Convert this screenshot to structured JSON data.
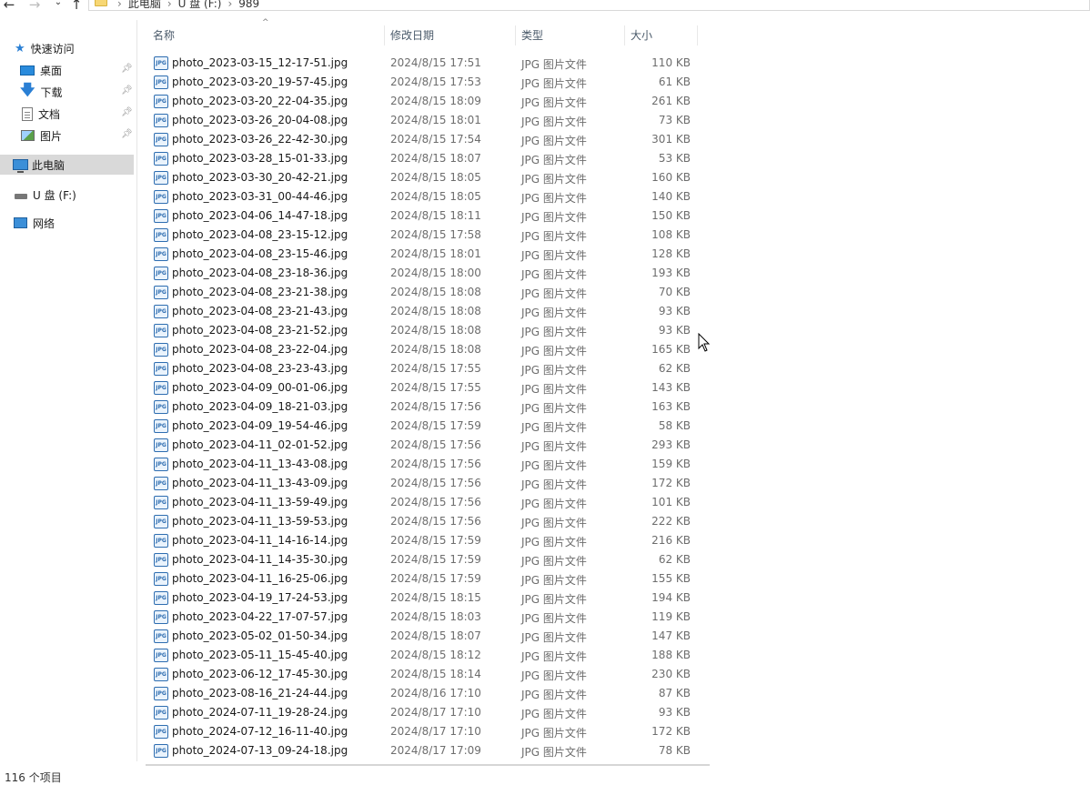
{
  "address_bar": {
    "back_icon": "arrow-left-icon",
    "forward_icon": "arrow-right-icon",
    "recent_icon": "chevron-down-icon",
    "up_icon": "arrow-up-icon",
    "breadcrumbs": [
      "此电脑",
      "U 盘 (F:)",
      "989"
    ]
  },
  "sidebar": {
    "items": [
      {
        "label": "快速访问",
        "icon": "star-icon",
        "pinned": false
      },
      {
        "label": "桌面",
        "icon": "desktop-icon",
        "pinned": true
      },
      {
        "label": "下载",
        "icon": "download-icon",
        "pinned": true
      },
      {
        "label": "文档",
        "icon": "document-icon",
        "pinned": true
      },
      {
        "label": "图片",
        "icon": "pictures-icon",
        "pinned": true
      },
      {
        "label": "此电脑",
        "icon": "computer-icon",
        "selected": true
      },
      {
        "label": "U 盘 (F:)",
        "icon": "usb-drive-icon"
      },
      {
        "label": "网络",
        "icon": "network-icon"
      }
    ]
  },
  "columns": {
    "name": "名称",
    "date": "修改日期",
    "type": "类型",
    "size": "大小"
  },
  "files": [
    {
      "name": "photo_2023-03-15_12-17-51.jpg",
      "date": "2024/8/15 17:51",
      "type": "JPG 图片文件",
      "size": "110 KB"
    },
    {
      "name": "photo_2023-03-20_19-57-45.jpg",
      "date": "2024/8/15 17:53",
      "type": "JPG 图片文件",
      "size": "61 KB"
    },
    {
      "name": "photo_2023-03-20_22-04-35.jpg",
      "date": "2024/8/15 18:09",
      "type": "JPG 图片文件",
      "size": "261 KB"
    },
    {
      "name": "photo_2023-03-26_20-04-08.jpg",
      "date": "2024/8/15 18:01",
      "type": "JPG 图片文件",
      "size": "73 KB"
    },
    {
      "name": "photo_2023-03-26_22-42-30.jpg",
      "date": "2024/8/15 17:54",
      "type": "JPG 图片文件",
      "size": "301 KB"
    },
    {
      "name": "photo_2023-03-28_15-01-33.jpg",
      "date": "2024/8/15 18:07",
      "type": "JPG 图片文件",
      "size": "53 KB"
    },
    {
      "name": "photo_2023-03-30_20-42-21.jpg",
      "date": "2024/8/15 18:05",
      "type": "JPG 图片文件",
      "size": "160 KB"
    },
    {
      "name": "photo_2023-03-31_00-44-46.jpg",
      "date": "2024/8/15 18:05",
      "type": "JPG 图片文件",
      "size": "140 KB"
    },
    {
      "name": "photo_2023-04-06_14-47-18.jpg",
      "date": "2024/8/15 18:11",
      "type": "JPG 图片文件",
      "size": "150 KB"
    },
    {
      "name": "photo_2023-04-08_23-15-12.jpg",
      "date": "2024/8/15 17:58",
      "type": "JPG 图片文件",
      "size": "108 KB"
    },
    {
      "name": "photo_2023-04-08_23-15-46.jpg",
      "date": "2024/8/15 18:01",
      "type": "JPG 图片文件",
      "size": "128 KB"
    },
    {
      "name": "photo_2023-04-08_23-18-36.jpg",
      "date": "2024/8/15 18:00",
      "type": "JPG 图片文件",
      "size": "193 KB"
    },
    {
      "name": "photo_2023-04-08_23-21-38.jpg",
      "date": "2024/8/15 18:08",
      "type": "JPG 图片文件",
      "size": "70 KB"
    },
    {
      "name": "photo_2023-04-08_23-21-43.jpg",
      "date": "2024/8/15 18:08",
      "type": "JPG 图片文件",
      "size": "93 KB"
    },
    {
      "name": "photo_2023-04-08_23-21-52.jpg",
      "date": "2024/8/15 18:08",
      "type": "JPG 图片文件",
      "size": "93 KB"
    },
    {
      "name": "photo_2023-04-08_23-22-04.jpg",
      "date": "2024/8/15 18:08",
      "type": "JPG 图片文件",
      "size": "165 KB"
    },
    {
      "name": "photo_2023-04-08_23-23-43.jpg",
      "date": "2024/8/15 17:55",
      "type": "JPG 图片文件",
      "size": "62 KB"
    },
    {
      "name": "photo_2023-04-09_00-01-06.jpg",
      "date": "2024/8/15 17:55",
      "type": "JPG 图片文件",
      "size": "143 KB"
    },
    {
      "name": "photo_2023-04-09_18-21-03.jpg",
      "date": "2024/8/15 17:56",
      "type": "JPG 图片文件",
      "size": "163 KB"
    },
    {
      "name": "photo_2023-04-09_19-54-46.jpg",
      "date": "2024/8/15 17:59",
      "type": "JPG 图片文件",
      "size": "58 KB"
    },
    {
      "name": "photo_2023-04-11_02-01-52.jpg",
      "date": "2024/8/15 17:56",
      "type": "JPG 图片文件",
      "size": "293 KB"
    },
    {
      "name": "photo_2023-04-11_13-43-08.jpg",
      "date": "2024/8/15 17:56",
      "type": "JPG 图片文件",
      "size": "159 KB"
    },
    {
      "name": "photo_2023-04-11_13-43-09.jpg",
      "date": "2024/8/15 17:56",
      "type": "JPG 图片文件",
      "size": "172 KB"
    },
    {
      "name": "photo_2023-04-11_13-59-49.jpg",
      "date": "2024/8/15 17:56",
      "type": "JPG 图片文件",
      "size": "101 KB"
    },
    {
      "name": "photo_2023-04-11_13-59-53.jpg",
      "date": "2024/8/15 17:56",
      "type": "JPG 图片文件",
      "size": "222 KB"
    },
    {
      "name": "photo_2023-04-11_14-16-14.jpg",
      "date": "2024/8/15 17:59",
      "type": "JPG 图片文件",
      "size": "216 KB"
    },
    {
      "name": "photo_2023-04-11_14-35-30.jpg",
      "date": "2024/8/15 17:59",
      "type": "JPG 图片文件",
      "size": "62 KB"
    },
    {
      "name": "photo_2023-04-11_16-25-06.jpg",
      "date": "2024/8/15 17:59",
      "type": "JPG 图片文件",
      "size": "155 KB"
    },
    {
      "name": "photo_2023-04-19_17-24-53.jpg",
      "date": "2024/8/15 18:15",
      "type": "JPG 图片文件",
      "size": "194 KB"
    },
    {
      "name": "photo_2023-04-22_17-07-57.jpg",
      "date": "2024/8/15 18:03",
      "type": "JPG 图片文件",
      "size": "119 KB"
    },
    {
      "name": "photo_2023-05-02_01-50-34.jpg",
      "date": "2024/8/15 18:07",
      "type": "JPG 图片文件",
      "size": "147 KB"
    },
    {
      "name": "photo_2023-05-11_15-45-40.jpg",
      "date": "2024/8/15 18:12",
      "type": "JPG 图片文件",
      "size": "188 KB"
    },
    {
      "name": "photo_2023-06-12_17-45-30.jpg",
      "date": "2024/8/15 18:14",
      "type": "JPG 图片文件",
      "size": "230 KB"
    },
    {
      "name": "photo_2023-08-16_21-24-44.jpg",
      "date": "2024/8/16 17:10",
      "type": "JPG 图片文件",
      "size": "87 KB"
    },
    {
      "name": "photo_2024-07-11_19-28-24.jpg",
      "date": "2024/8/17 17:10",
      "type": "JPG 图片文件",
      "size": "93 KB"
    },
    {
      "name": "photo_2024-07-12_16-11-40.jpg",
      "date": "2024/8/17 17:10",
      "type": "JPG 图片文件",
      "size": "172 KB"
    },
    {
      "name": "photo_2024-07-13_09-24-18.jpg",
      "date": "2024/8/17 17:09",
      "type": "JPG 图片文件",
      "size": "78 KB"
    }
  ],
  "file_icon_text": "JPG",
  "status_bar": {
    "item_count": "116 个项目"
  },
  "colors": {
    "selection": "#d9d9d9",
    "header_text": "#4a5a6a",
    "accent": "#2a7fd4"
  }
}
